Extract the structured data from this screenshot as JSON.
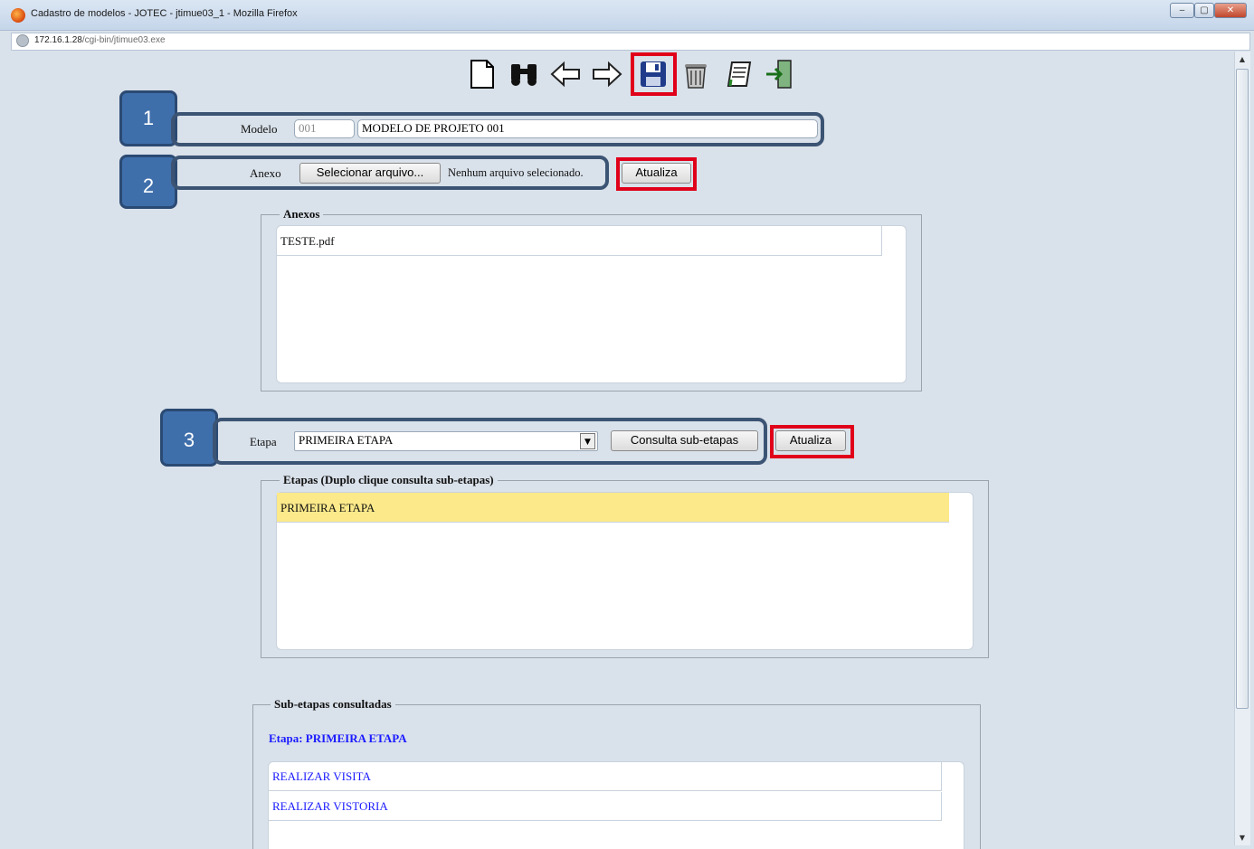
{
  "window": {
    "title": "Cadastro de modelos - JOTEC - jtimue03_1 - Mozilla Firefox",
    "buttons": [
      "‒",
      "▢",
      "✕"
    ]
  },
  "address": {
    "host": "172.16.1.28",
    "path": "/cgi-bin/jtimue03.exe"
  },
  "toolbar": {
    "icons": [
      "new-document-icon",
      "binoculars-search-icon",
      "arrow-left-icon",
      "arrow-right-icon",
      "save-disk-icon",
      "trash-icon",
      "notebook-icon",
      "exit-door-icon"
    ]
  },
  "callouts": {
    "one": "1",
    "two": "2",
    "three": "3"
  },
  "modelo": {
    "label": "Modelo",
    "code": "001",
    "name": "MODELO DE PROJETO 001"
  },
  "anexo": {
    "label": "Anexo",
    "select_button": "Selecionar arquivo...",
    "file_status": "Nenhum arquivo selecionado.",
    "update_button": "Atualiza"
  },
  "anexos": {
    "legend": "Anexos",
    "items": [
      "TESTE.pdf"
    ]
  },
  "etapa": {
    "label": "Etapa",
    "selected": "PRIMEIRA ETAPA",
    "consult_button": "Consulta sub-etapas",
    "update_button": "Atualiza"
  },
  "etapas": {
    "legend": "Etapas (Duplo clique consulta sub-etapas)",
    "items": [
      "PRIMEIRA ETAPA"
    ]
  },
  "subetapas": {
    "legend": "Sub-etapas consultadas",
    "heading": "Etapa: PRIMEIRA ETAPA",
    "items": [
      "REALIZAR VISITA",
      "REALIZAR VISTORIA"
    ]
  },
  "colors": {
    "accent_red": "#e0001a",
    "callout_blue": "#3f6fab",
    "highlight_yellow": "#fbe98a",
    "link_blue": "#1a1aff"
  }
}
